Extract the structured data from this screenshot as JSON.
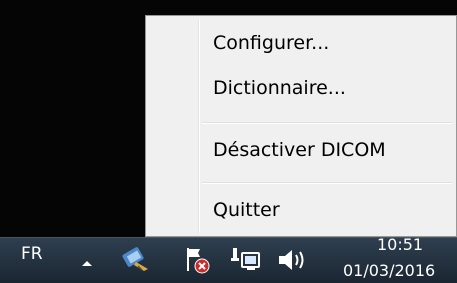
{
  "context_menu": {
    "items": [
      {
        "label": "Configurer..."
      },
      {
        "label": "Dictionnaire..."
      },
      {
        "label": "Désactiver DICOM"
      },
      {
        "label": "Quitter"
      }
    ]
  },
  "taskbar": {
    "language": "FR",
    "tray_icons": [
      "show-hidden-icons",
      "dicom-app-icon",
      "action-center-flag-icon",
      "network-icon",
      "volume-icon"
    ],
    "clock": {
      "time": "10:51",
      "date": "01/03/2016"
    }
  }
}
